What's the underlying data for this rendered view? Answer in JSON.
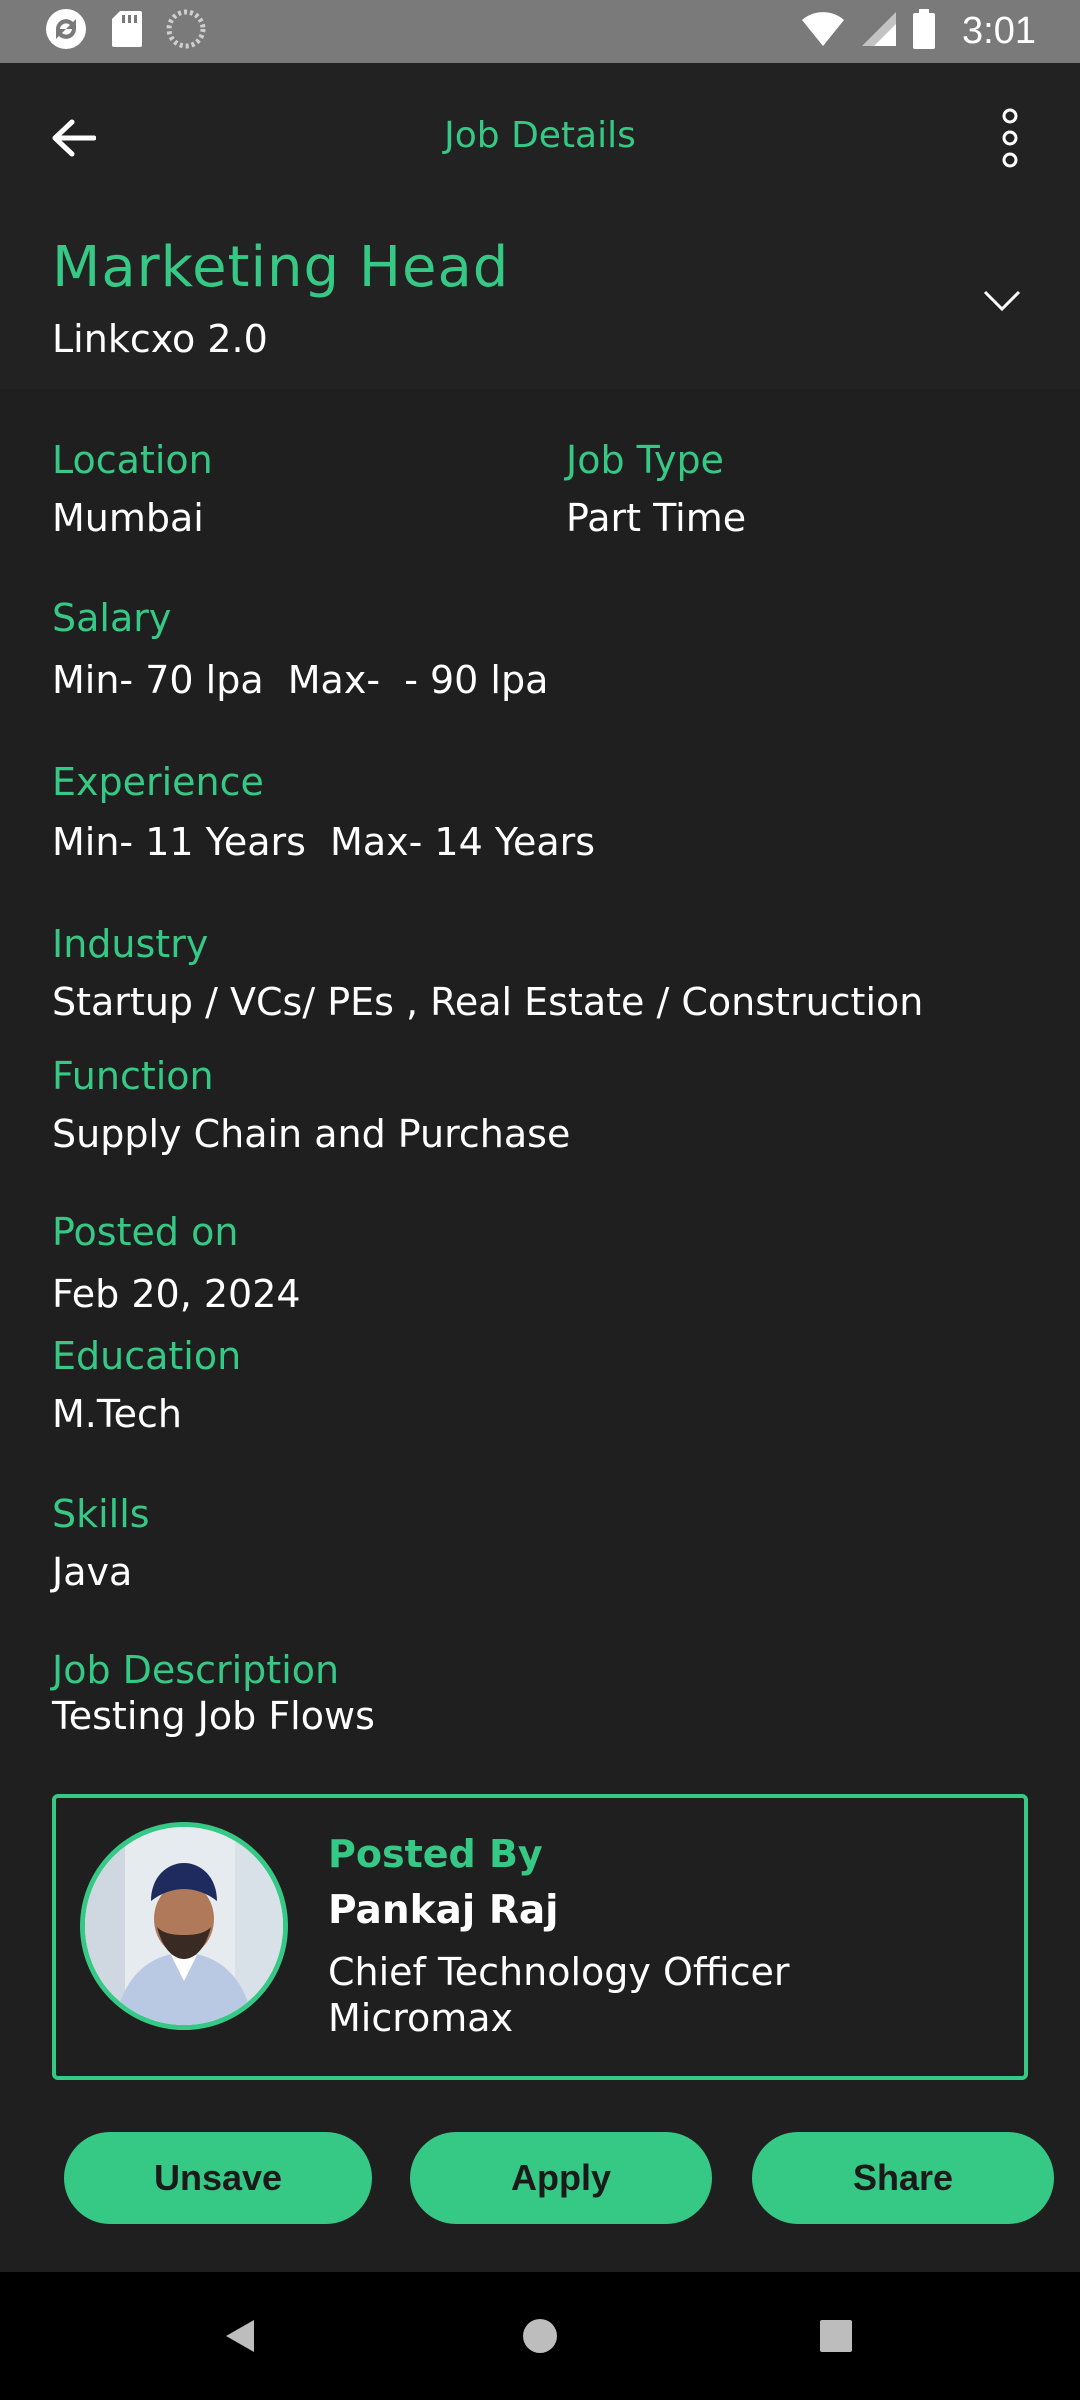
{
  "status_bar": {
    "time": "3:01"
  },
  "app_bar": {
    "title": "Job Details"
  },
  "job": {
    "title": "Marketing Head",
    "company": "Linkcxo 2.0"
  },
  "details": {
    "location_label": "Location",
    "location_value": "Mumbai",
    "job_type_label": "Job Type",
    "job_type_value": "Part Time",
    "salary_label": "Salary",
    "salary_value": "Min- 70 lpa  Max-  - 90 lpa",
    "experience_label": "Experience",
    "experience_value": "Min- 11 Years  Max- 14 Years",
    "industry_label": "Industry",
    "industry_value": "Startup / VCs/ PEs , Real Estate / Construction",
    "function_label": "Function",
    "function_value": "Supply Chain and Purchase",
    "posted_on_label": "Posted on",
    "posted_on_value": "Feb 20, 2024",
    "education_label": "Education",
    "education_value": "M.Tech",
    "skills_label": "Skills",
    "skills_value": "Java",
    "description_label": "Job Description",
    "description_value": "Testing Job Flows"
  },
  "poster": {
    "label": "Posted By",
    "name": "Pankaj Raj",
    "role": "Chief Technology Officer",
    "company": "Micromax"
  },
  "actions": {
    "unsave": "Unsave",
    "apply": "Apply",
    "share": "Share"
  },
  "colors": {
    "accent": "#35c985",
    "background": "#1f1f1f",
    "bar": "#222222"
  }
}
